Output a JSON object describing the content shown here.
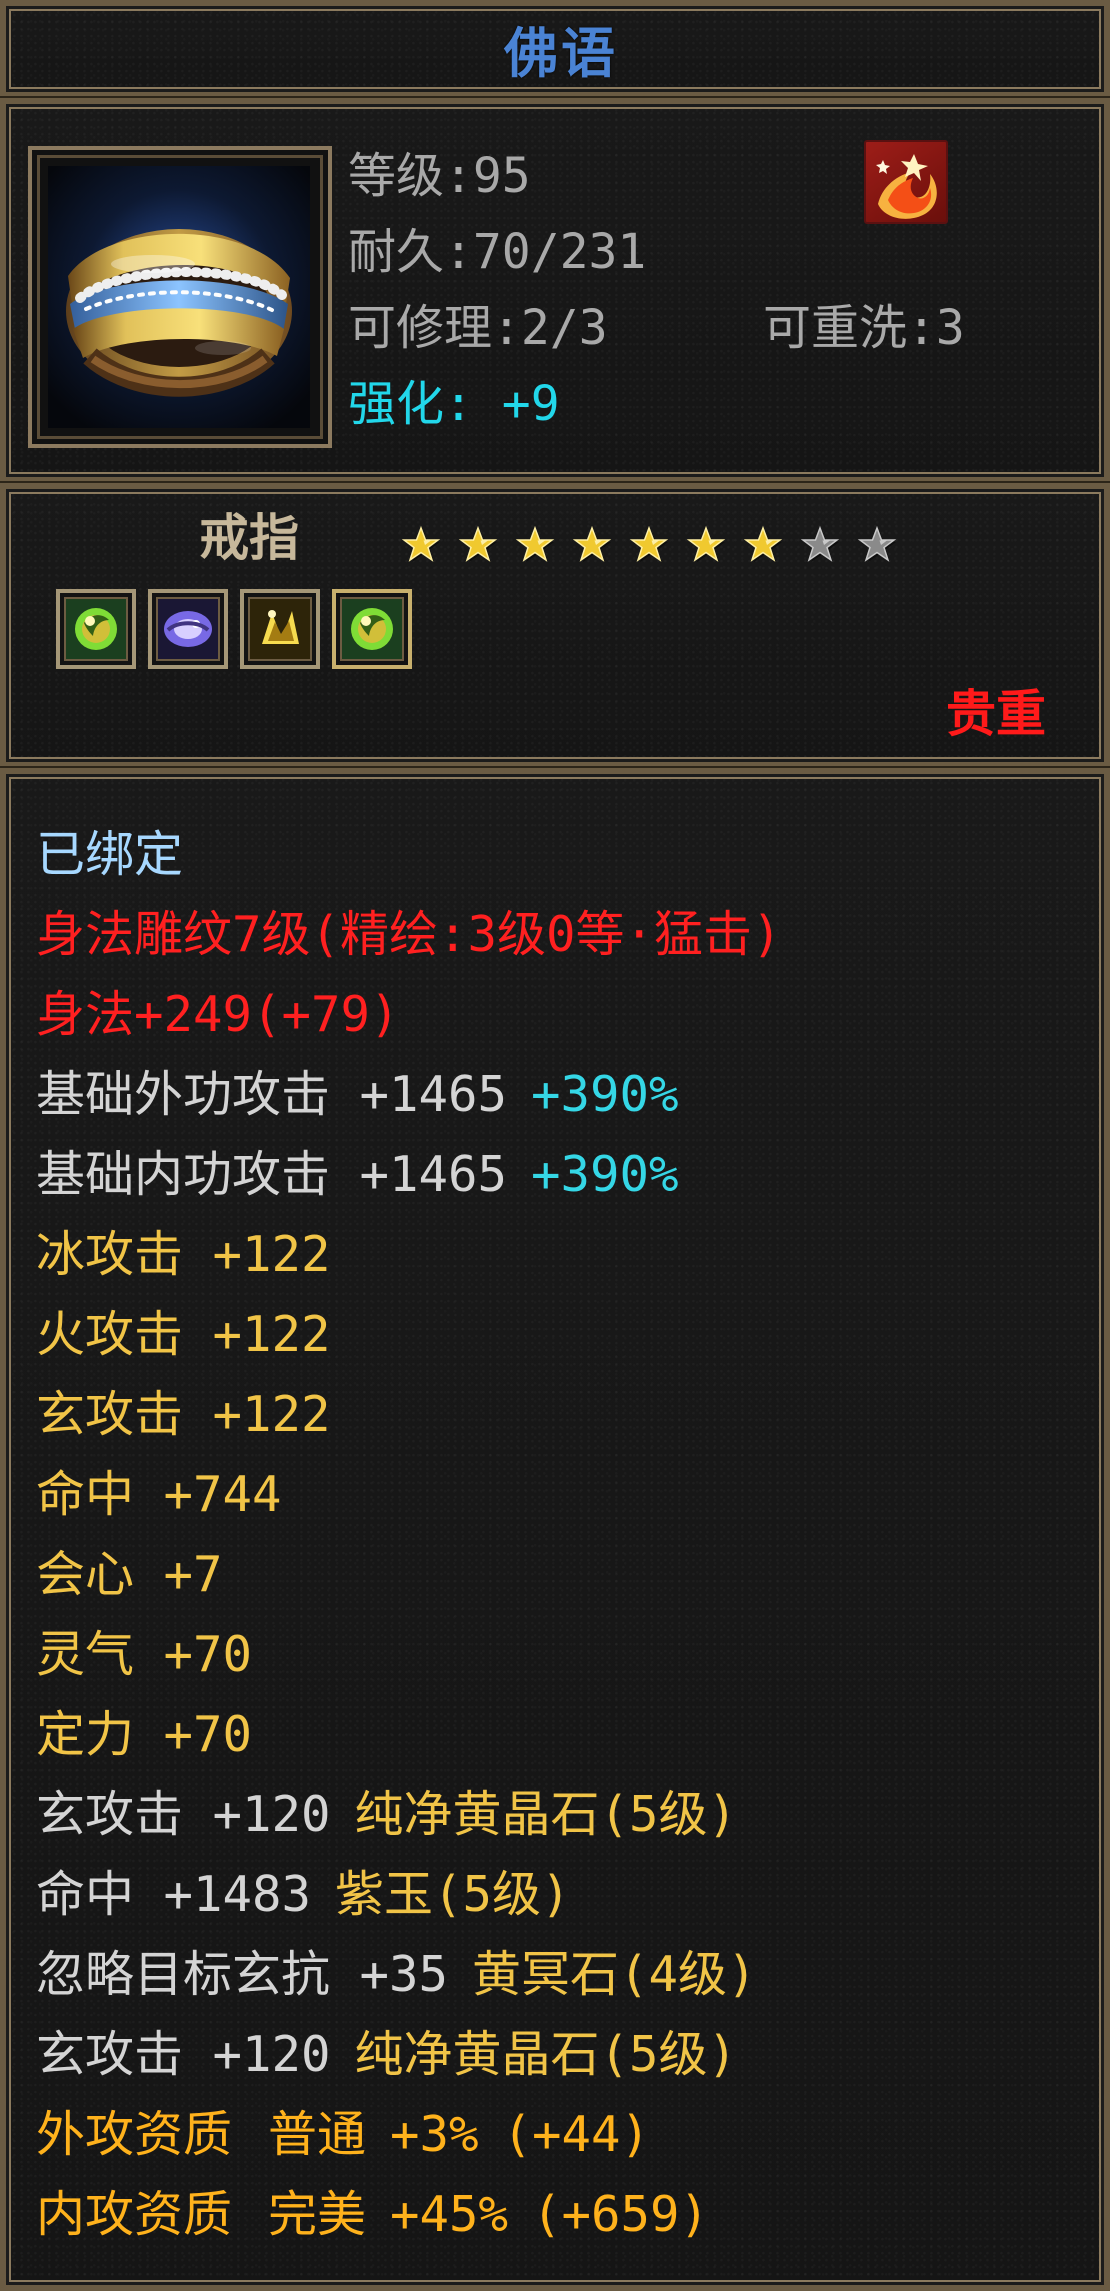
{
  "item": {
    "title": "佛语",
    "type": "戒指",
    "quality": "贵重",
    "star_count": 7,
    "star_total": 9,
    "icon": "ring-icon",
    "badge_icon": "fire-badge-icon"
  },
  "info": {
    "level": "等级:95",
    "durability": "耐久:70/231",
    "repairable": "可修理:2/3",
    "rewash": "可重洗:3",
    "enhance": "强化: +9"
  },
  "gems": [
    {
      "name": "green-gem-icon"
    },
    {
      "name": "purple-gem-icon"
    },
    {
      "name": "yellow-gem-icon"
    },
    {
      "name": "green-gem-icon"
    }
  ],
  "stats": {
    "bound": "已绑定",
    "engraving": "身法雕纹7级(精绘:3级0等·猛击)",
    "body_skill": "身法+249(+79)",
    "line4_main": "基础外功攻击 +1465",
    "line4_extra": "+390%",
    "line5_main": "基础内功攻击 +1465",
    "line5_extra": "+390%",
    "ice_attack": "冰攻击 +122",
    "fire_attack": "火攻击 +122",
    "mystic_attack": "玄攻击 +122",
    "hit": "命中 +744",
    "crit": "会心 +7",
    "spirit": "灵气 +70",
    "fortitude": "定力 +70",
    "gem1_stat": "玄攻击 +120",
    "gem1_name": "纯净黄晶石(5级)",
    "gem2_stat": "命中 +1483",
    "gem2_name": "紫玉(5级)",
    "gem3_stat": "忽略目标玄抗 +35",
    "gem3_name": "黄冥石(4级)",
    "gem4_stat": "玄攻击 +120",
    "gem4_name": "纯净黄晶石(5级)",
    "outer_quality_label": "外攻资质",
    "outer_quality_grade": "普通",
    "outer_quality_value": "+3%",
    "outer_quality_extra": "(+44)",
    "inner_quality_label": "内攻资质",
    "inner_quality_grade": "完美",
    "inner_quality_value": "+45%",
    "inner_quality_extra": "(+659)"
  }
}
